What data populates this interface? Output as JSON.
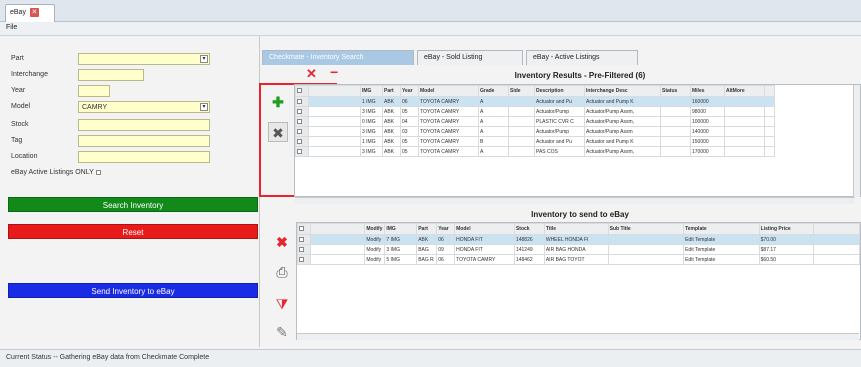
{
  "window": {
    "tab_title": "eBay",
    "menu": "File"
  },
  "left": {
    "fields": [
      {
        "label": "Part",
        "value": ""
      },
      {
        "label": "Interchange",
        "value": ""
      },
      {
        "label": "Year",
        "value": ""
      },
      {
        "label": "Model",
        "value": "CAMRY"
      },
      {
        "label": "Stock",
        "value": ""
      },
      {
        "label": "Tag",
        "value": ""
      },
      {
        "label": "Location",
        "value": ""
      }
    ],
    "checkbox_label": "eBay Active Listings ONLY",
    "search_btn": "Search Inventory",
    "reset_btn": "Reset",
    "send_btn": "Send Inventory to eBay"
  },
  "tabs": [
    "Checkmate - Inventory Search",
    "eBay - Sold Listing",
    "eBay - Active Listings"
  ],
  "inventory": {
    "title": "Inventory Results - Pre-Filtered (6)",
    "columns": [
      "IMG",
      "Part",
      "Year",
      "Model",
      "Grade",
      "Side",
      "Description",
      "Interchange Desc",
      "Status",
      "Miles",
      "AltMore"
    ],
    "rows": [
      [
        "1 IMG",
        "ABK",
        "06",
        "TOYOTA CAMRY",
        "A",
        "",
        "Actuator and Pu",
        "Actuator and Pump K",
        "",
        "160000",
        ""
      ],
      [
        "3 IMG",
        "ABK",
        "05",
        "TOYOTA CAMRY",
        "A",
        "",
        "Actuator/Pump",
        "Actuator/Pump Assm,",
        "",
        "98000",
        ""
      ],
      [
        "0 IMG",
        "ABK",
        "04",
        "TOYOTA CAMRY",
        "A",
        "",
        "PLASTIC CVR C",
        "Actuator/Pump Assm, ",
        "",
        "100000",
        ""
      ],
      [
        "3 IMG",
        "ABK",
        "03",
        "TOYOTA CAMRY",
        "A",
        "",
        "Actuator/Pump",
        "Actuator/Pump Assm",
        "",
        "140000",
        ""
      ],
      [
        "1 IMG",
        "ABK",
        "05",
        "TOYOTA CAMRY",
        "B",
        "",
        "Actuator and Pu",
        "Actuator and Pump K",
        "",
        "150000",
        ""
      ],
      [
        "3 IMG",
        "ABK",
        "05",
        "TOYOTA CAMRY",
        "A",
        "",
        "PAS COS",
        "Actuator/Pump Assm,",
        "",
        "170000",
        ""
      ]
    ]
  },
  "send": {
    "title": "Inventory to send to eBay",
    "columns": [
      "Modify",
      "IMG",
      "Part",
      "Year",
      "Model",
      "Stock",
      "Title",
      "Sub Title",
      "Template",
      "Listing Price"
    ],
    "rows": [
      [
        "Modify",
        "7 IMG",
        "ABK",
        "06",
        "HONDA FIT",
        "148826",
        "WHEEL HONDA FI",
        "",
        "Edit Template",
        "$70.00"
      ],
      [
        "Modify",
        "3 IMG",
        "BAG",
        "09",
        "HONDA FIT",
        "141249",
        "AIR BAG HONDA",
        "",
        "Edit Template",
        "$87.17"
      ],
      [
        "Modify",
        "5 IMG",
        "BAG R",
        "06",
        "TOYOTA CAMRY",
        "148462",
        "AIR BAG TOYOT",
        "",
        "Edit Template",
        "$60.50"
      ]
    ]
  },
  "status": "Current Status -- Gathering eBay data from Checkmate Complete",
  "colors": {
    "search": "#118a1a",
    "reset": "#e81a1a",
    "send": "#1a2be6",
    "highlight": "#e8252f"
  },
  "icons": [
    "add-icon",
    "remove-icon",
    "delete-icon",
    "print-icon",
    "filter-icon",
    "edit-icon"
  ]
}
